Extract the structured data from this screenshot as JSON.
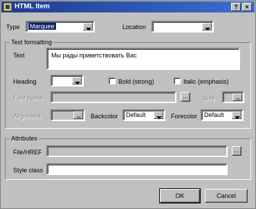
{
  "window": {
    "title": "HTML Item",
    "help_label": "?",
    "close_label": "×"
  },
  "top": {
    "type_label": "Type",
    "type_value": "Marquee",
    "location_label": "Location",
    "location_value": ""
  },
  "text_formatting": {
    "legend": "Text formatting",
    "text_label": "Text",
    "text_value": "Мы рады приветствовать Вас",
    "heading_label": "Heading",
    "heading_value": "",
    "bold_label": "Bold (strong)",
    "italic_label": "Italic (emphasis)",
    "font_name_label": "Font name",
    "font_browse_label": "...",
    "size_label": "Size",
    "alignment_label": "Alignment",
    "backcolor_label": "Backcolor",
    "backcolor_value": "Default",
    "forecolor_label": "Forecolor",
    "forecolor_value": "Default"
  },
  "attributes": {
    "legend": "Attributes",
    "file_href_label": "File/HREF",
    "file_browse_label": "...",
    "style_class_label": "Style class",
    "style_class_value": ""
  },
  "buttons": {
    "ok_label": "OK",
    "cancel_label": "Cancel"
  },
  "colors": {
    "titlebar_start": "#1e3b8f",
    "titlebar_end": "#3b6fd0",
    "face": "#c0c0c0",
    "selection": "#0b246a"
  }
}
